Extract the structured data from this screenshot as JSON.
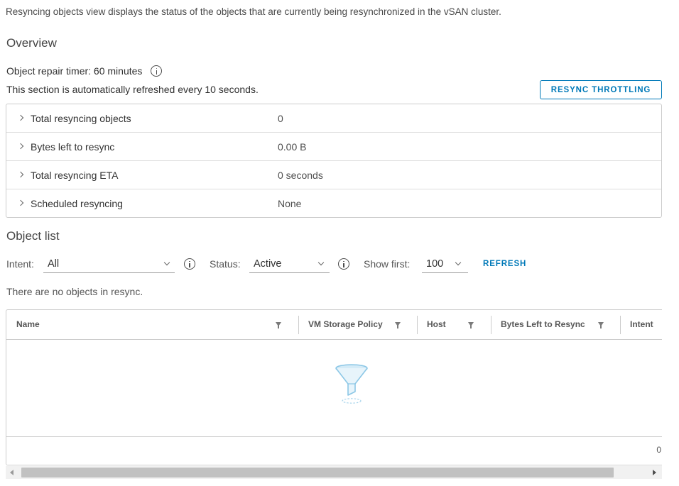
{
  "description": "Resyncing objects view displays the status of the objects that are currently being resynchronized in the vSAN cluster.",
  "overview": {
    "title": "Overview",
    "repair_timer": "Object repair timer: 60 minutes",
    "refresh_note": "This section is automatically refreshed every 10 seconds.",
    "throttle_button": "RESYNC THROTTLING"
  },
  "summary": [
    {
      "label": "Total resyncing objects",
      "value": "0"
    },
    {
      "label": "Bytes left to resync",
      "value": "0.00 B"
    },
    {
      "label": "Total resyncing ETA",
      "value": "0 seconds"
    },
    {
      "label": "Scheduled resyncing",
      "value": "None"
    }
  ],
  "object_list": {
    "title": "Object list",
    "intent_label": "Intent:",
    "intent_value": "All",
    "status_label": "Status:",
    "status_value": "Active",
    "show_first_label": "Show first:",
    "show_first_value": "100",
    "refresh_label": "REFRESH",
    "empty_message": "There are no objects in resync."
  },
  "grid": {
    "columns": [
      "Name",
      "VM Storage Policy",
      "Host",
      "Bytes Left to Resync",
      "Intent"
    ],
    "footer_count": "0",
    "placeholder_icon": "filter-funnel-icon"
  },
  "colors": {
    "accent": "#0079b8",
    "border": "#cccccc",
    "text": "#313131",
    "funnel": "#8cc7e6"
  }
}
